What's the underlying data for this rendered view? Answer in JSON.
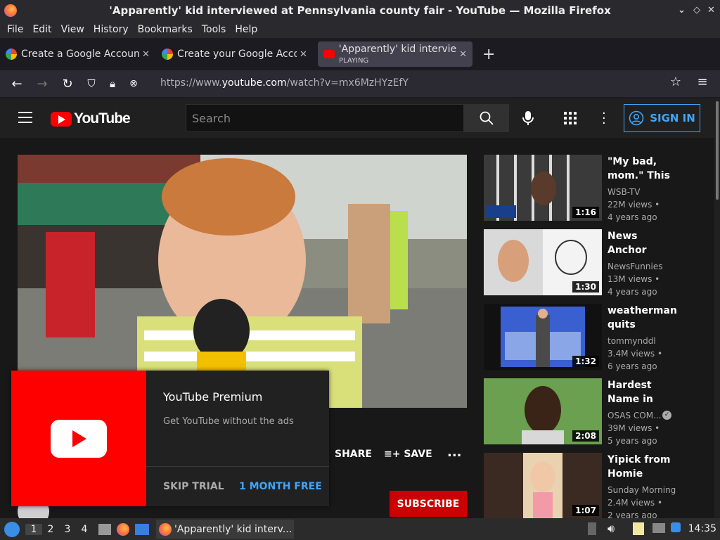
{
  "window": {
    "title": "'Apparently' kid interviewed at Pennsylvania county fair - YouTube — Mozilla Firefox"
  },
  "menu": [
    "File",
    "Edit",
    "View",
    "History",
    "Bookmarks",
    "Tools",
    "Help"
  ],
  "tabs": [
    {
      "title": "Create a Google Account",
      "color": "#4285f4"
    },
    {
      "title": "Create your Google Acco",
      "color": "#34a853"
    },
    {
      "title": "'Apparently' kid interview",
      "sub": "PLAYING",
      "color": "#f00"
    }
  ],
  "nav": {
    "url_prefix": "https://www.",
    "url_host": "youtube.com",
    "url_path": "/watch?v=mx6MzHYzEfY"
  },
  "yt": {
    "logo": "YouTube",
    "search_placeholder": "Search",
    "signin": "SIGN IN",
    "share": "SHARE",
    "save": "SAVE",
    "more": "...",
    "subscribe": "SUBSCRIBE",
    "premium": {
      "title": "YouTube Premium",
      "desc": "Get YouTube without the ads",
      "skip": "SKIP TRIAL",
      "month": "1 MONTH FREE"
    }
  },
  "recs": [
    {
      "title": "\"My bad, mom.\" This might be...",
      "channel": "WSB-TV",
      "views": "22M views •",
      "age": "4 years ago",
      "duration": "1:16"
    },
    {
      "title": "News Anchor Laughs At...",
      "channel": "NewsFunnies",
      "views": "13M views •",
      "age": "4 years ago",
      "duration": "1:30"
    },
    {
      "title": "weatherman quits",
      "channel": "tommynddl",
      "views": "3.4M views •",
      "age": "6 years ago",
      "duration": "1:32"
    },
    {
      "title": "Hardest Name in Africa",
      "channel": "OSAS COM...",
      "views": "39M views •",
      "age": "5 years ago",
      "duration": "2:08"
    },
    {
      "title": "Yipick from Homie Depot",
      "channel": "Sunday Morning ...",
      "views": "2.4M views •",
      "age": "2 years ago",
      "duration": "1:07"
    }
  ],
  "taskbar": {
    "workspaces": [
      "1",
      "2",
      "3",
      "4"
    ],
    "app": "'Apparently' kid interv...",
    "clock": "14:35"
  }
}
